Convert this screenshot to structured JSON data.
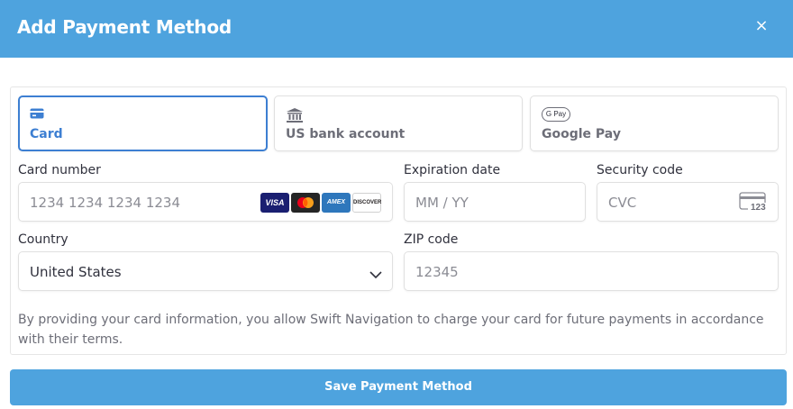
{
  "header": {
    "title": "Add Payment Method",
    "close_glyph": "×"
  },
  "tabs": [
    {
      "label": "Card",
      "icon": "credit-card-icon",
      "active": true
    },
    {
      "label": "US bank account",
      "icon": "bank-icon",
      "active": false
    },
    {
      "label": "Google Pay",
      "icon": "google-pay-icon",
      "active": false,
      "icon_text": "G Pay"
    }
  ],
  "form": {
    "card_number": {
      "label": "Card number",
      "placeholder": "1234 1234 1234 1234"
    },
    "card_brands": [
      "VISA",
      "mastercard",
      "AMEX",
      "DISCOVER"
    ],
    "expiration": {
      "label": "Expiration date",
      "placeholder": "MM / YY"
    },
    "security": {
      "label": "Security code",
      "placeholder": "CVC",
      "icon_text": "123"
    },
    "country": {
      "label": "Country",
      "value": "United States"
    },
    "zip": {
      "label": "ZIP code",
      "placeholder": "12345"
    }
  },
  "terms": "By providing your card information, you allow Swift Navigation to charge your card for future payments in accordance with their terms.",
  "save_button": "Save Payment Method",
  "colors": {
    "header": "#4ea3de",
    "accent": "#3d7fd2",
    "button": "#4ea3de"
  }
}
